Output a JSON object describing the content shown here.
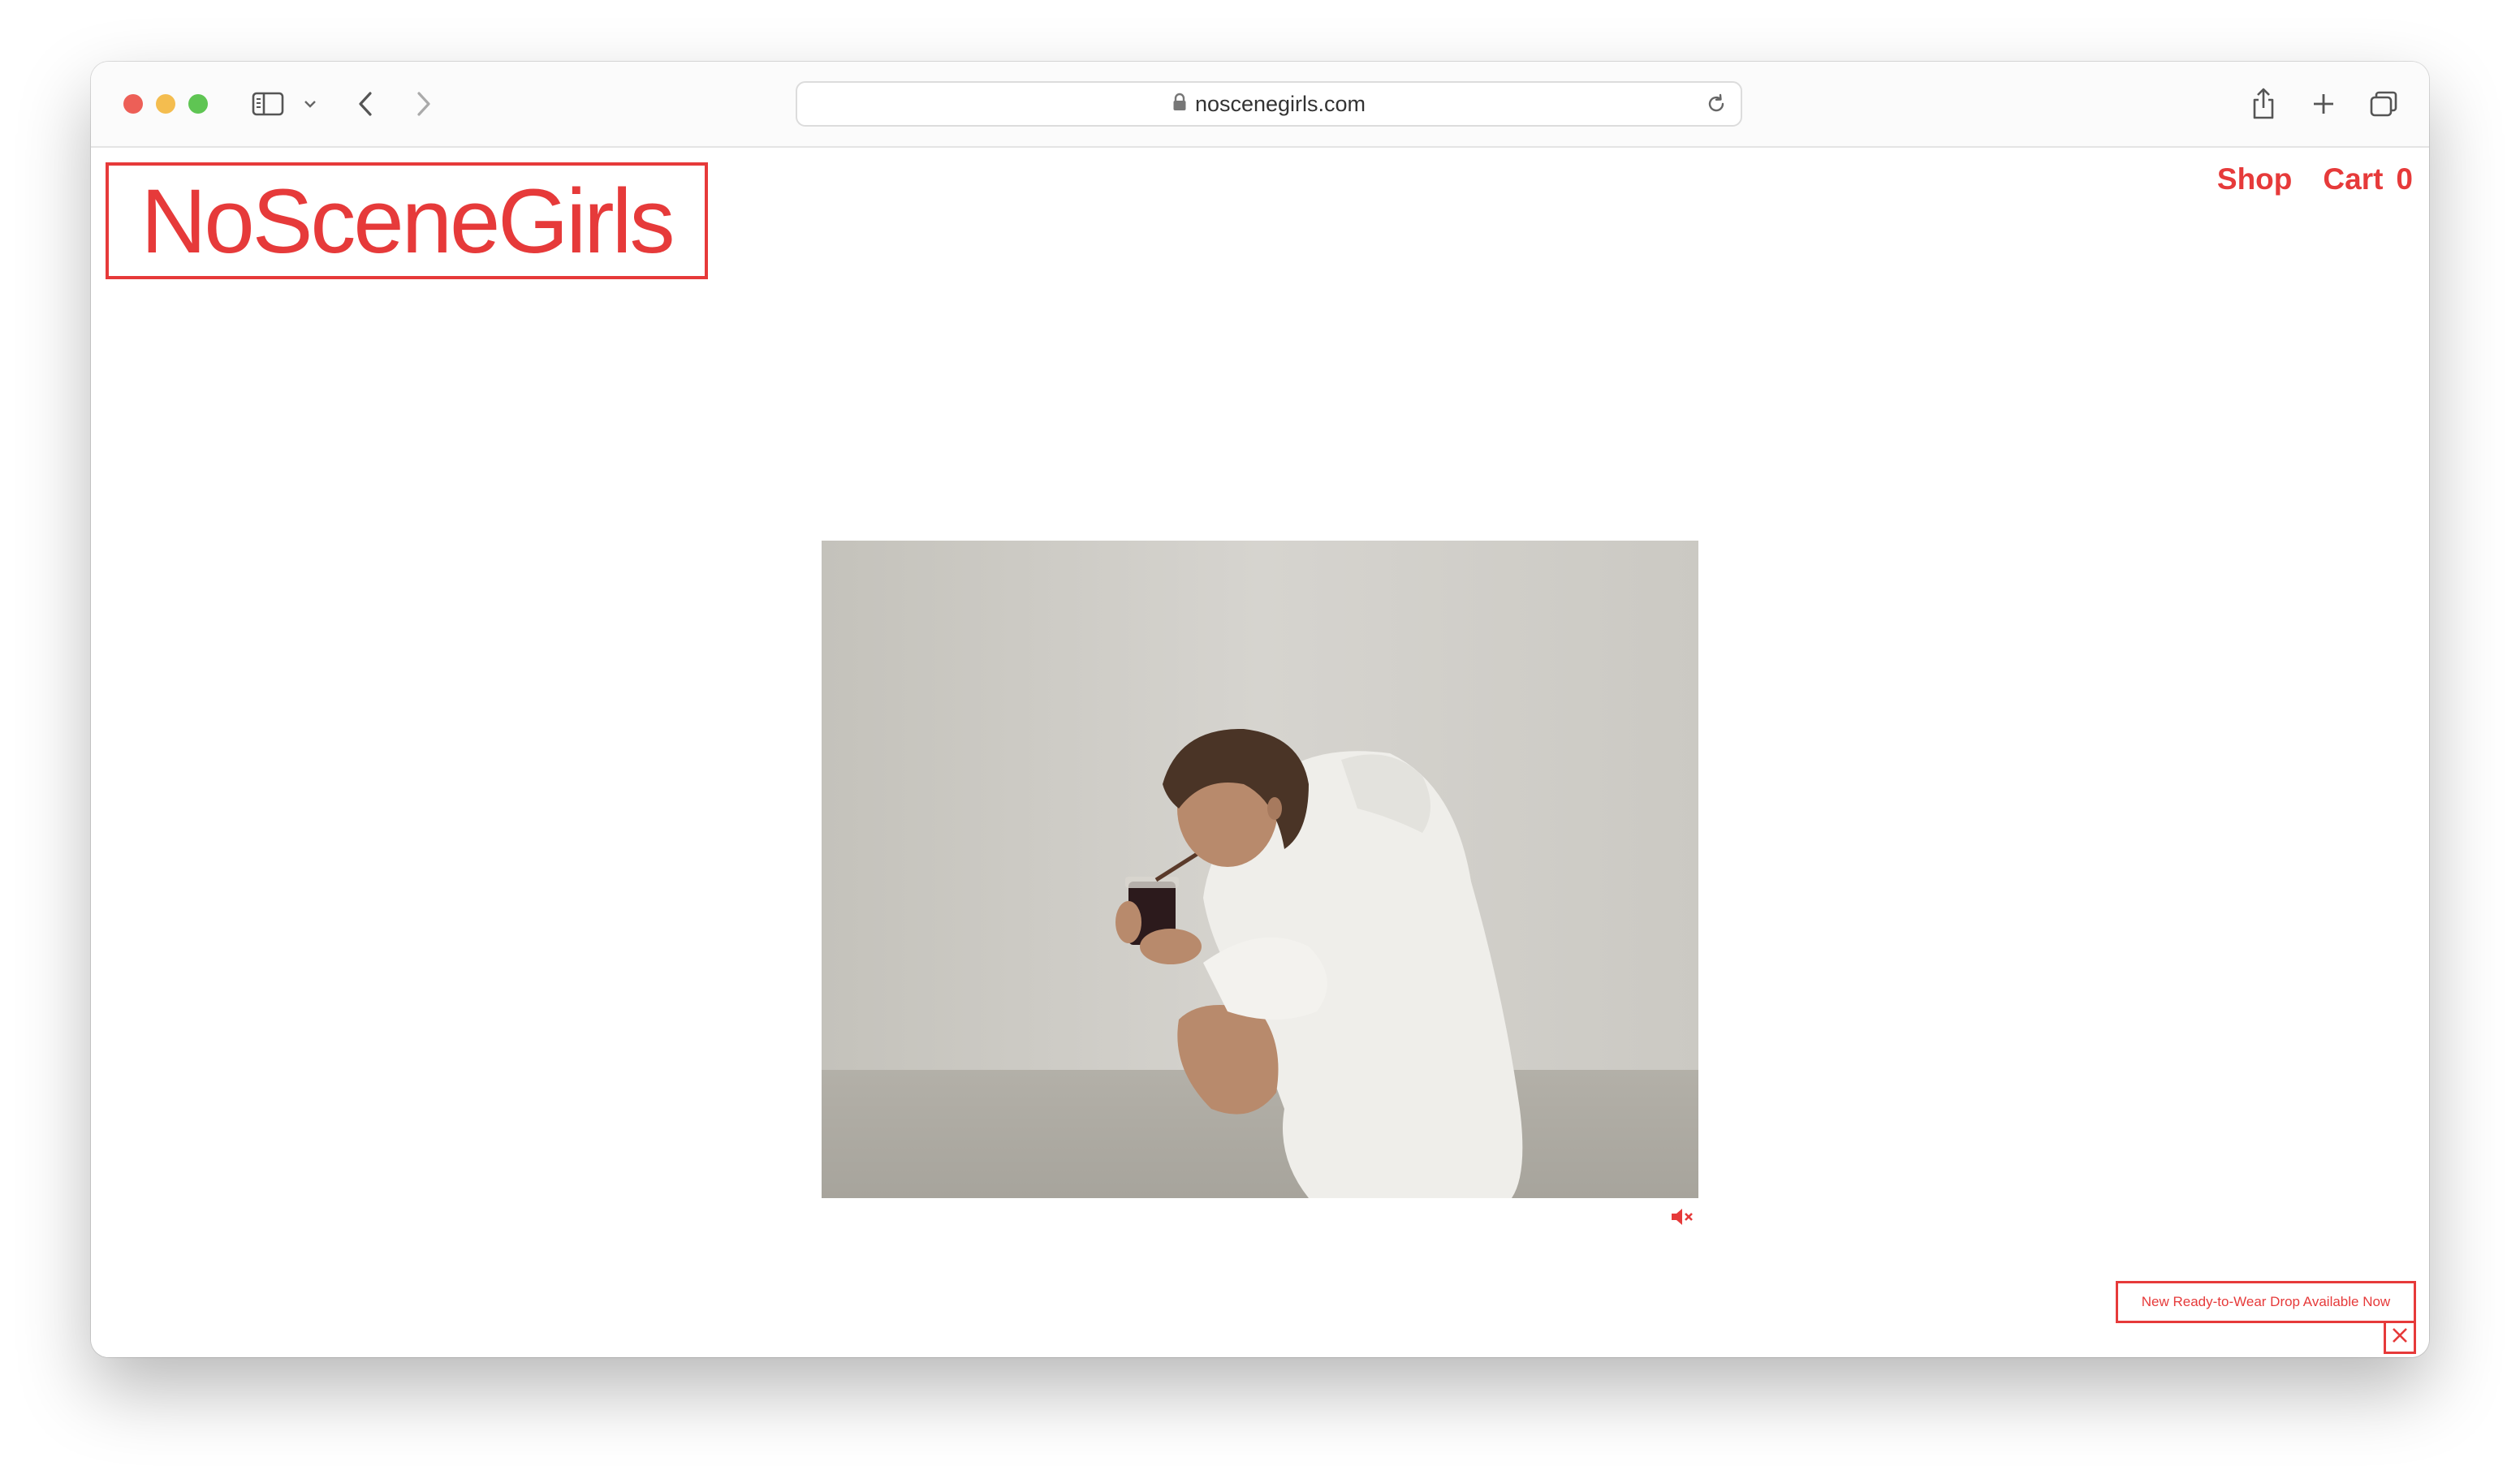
{
  "browser": {
    "url": "noscenegirls.com"
  },
  "site": {
    "logo": "NoSceneGirls",
    "nav": {
      "shop": "Shop",
      "cart_label": "Cart",
      "cart_count": "0"
    },
    "promo_banner": "New Ready-to-Wear Drop Available Now"
  },
  "colors": {
    "brand": "#e63a3a"
  },
  "icons": {
    "sidebar": "sidebar-icon",
    "back": "chevron-left-icon",
    "forward": "chevron-right-icon",
    "lock": "lock-icon",
    "reload": "reload-icon",
    "share": "share-icon",
    "new_tab": "plus-icon",
    "tabs": "tabs-icon",
    "mute": "mute-icon",
    "close": "close-icon"
  }
}
